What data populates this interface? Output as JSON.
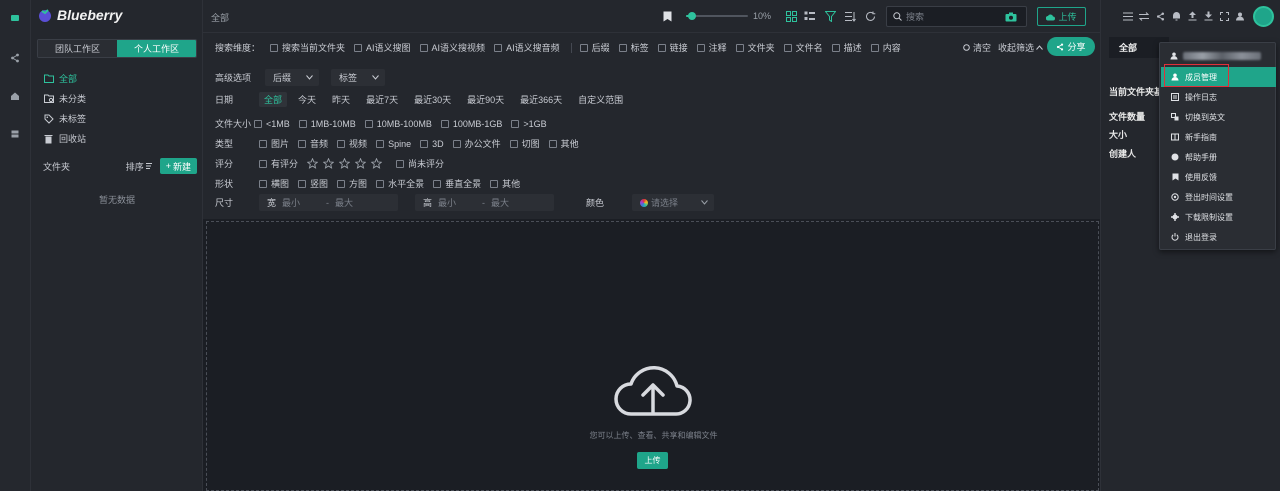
{
  "app": {
    "name": "Blueberry"
  },
  "sidebar": {
    "tabs": [
      {
        "label": "团队工作区",
        "active": false
      },
      {
        "label": "个人工作区",
        "active": true
      }
    ],
    "items": [
      {
        "label": "全部",
        "icon": "folder-icon",
        "active": true
      },
      {
        "label": "未分类",
        "icon": "uncategorized-icon",
        "active": false
      },
      {
        "label": "未标签",
        "icon": "tag-icon",
        "active": false
      },
      {
        "label": "回收站",
        "icon": "trash-icon",
        "active": false
      }
    ],
    "folder_label": "文件夹",
    "sort_label": "排序",
    "new_label": "新建",
    "empty_text": "暂无数据"
  },
  "topbar": {
    "breadcrumb": "全部",
    "zoom_value": "10%",
    "zoom_fraction": 0.1,
    "search_placeholder": "搜索",
    "upload_label": "上传"
  },
  "filters": {
    "scope_label": "搜索维度：",
    "scope_options": [
      "搜索当前文件夹",
      "AI语义搜图",
      "AI语义搜视频",
      "AI语义搜音频"
    ],
    "field_options": [
      "后缀",
      "标签",
      "链接",
      "注释",
      "文件夹",
      "文件名",
      "描述",
      "内容"
    ],
    "clear_label": "清空",
    "collapse_label": "收起筛选",
    "share_label": "分享",
    "advanced_label": "高级选项",
    "advanced_selects": [
      "后缀",
      "标签"
    ],
    "date_label": "日期",
    "date_options": [
      "全部",
      "今天",
      "昨天",
      "最近7天",
      "最近30天",
      "最近90天",
      "最近366天",
      "自定义范围"
    ],
    "size_label": "文件大小",
    "size_options": [
      "<1MB",
      "1MB-10MB",
      "10MB-100MB",
      "100MB-1GB",
      ">1GB"
    ],
    "type_label": "类型",
    "type_options": [
      "图片",
      "音频",
      "视频",
      "Spine",
      "3D",
      "办公文件",
      "切图",
      "其他"
    ],
    "rating_label": "评分",
    "rating_has": "有评分",
    "rating_none": "尚未评分",
    "shape_label": "形状",
    "shape_options": [
      "横图",
      "竖图",
      "方图",
      "水平全景",
      "垂直全景",
      "其他"
    ],
    "dim_label": "尺寸",
    "width_label": "宽",
    "height_label": "高",
    "min_placeholder": "最小",
    "max_placeholder": "最大",
    "color_label": "颜色",
    "color_placeholder": "请选择"
  },
  "dropzone": {
    "text": "您可以上传、查看、共享和编辑文件",
    "upload_label": "上传"
  },
  "right_panel": {
    "tab": "全部",
    "title": "当前文件夹基本",
    "fields": [
      "文件数量",
      "大小",
      "创建人"
    ]
  },
  "menu": {
    "items": [
      {
        "label": "成员管理",
        "icon": "member-icon",
        "active": true
      },
      {
        "label": "操作日志",
        "icon": "log-icon",
        "active": false
      },
      {
        "label": "切换到英文",
        "icon": "translate-icon",
        "active": false
      },
      {
        "label": "新手指南",
        "icon": "guide-icon",
        "active": false
      },
      {
        "label": "帮助手册",
        "icon": "help-icon",
        "active": false
      },
      {
        "label": "使用反馈",
        "icon": "feedback-icon",
        "active": false
      },
      {
        "label": "登出时间设置",
        "icon": "settings-icon",
        "active": false
      },
      {
        "label": "下载限制设置",
        "icon": "gear-icon",
        "active": false
      },
      {
        "label": "退出登录",
        "icon": "power-icon",
        "active": false
      }
    ]
  },
  "colors": {
    "accent": "#1fa58a",
    "accent_light": "#2ec29d",
    "bg": "#1b1e24",
    "panel": "#24272d",
    "highlight": "#e0303a"
  }
}
